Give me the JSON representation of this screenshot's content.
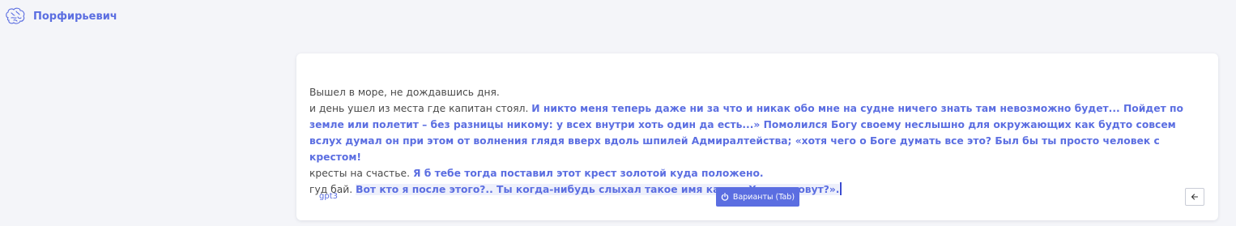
{
  "app": {
    "title": "Порфирьевич",
    "logo_icon": "brain-icon"
  },
  "editor": {
    "lines": [
      {
        "user": "Вышел в море, не дождавшись дня.",
        "generated": ""
      },
      {
        "user": "и день ушел из места где капитан стоял.",
        "generated": "И никто меня теперь даже ни за что и никак обо мне на судне ничего знать там невозможно будет... Пойдет по земле или полетит – без разницы никому: у всех внутри хоть один да есть...» Помолился Богу своему неслышно для окружающих как будто совсем вслух думал он при этом от волнения глядя вверх вдоль шпилей Адмиралтейства; «хотя чего о Боге думать все это? Был бы ты просто человек с крестом!"
      },
      {
        "user": "кресты на счастье.",
        "generated": "Я б тебе тогда поставил этот крест золотой куда положено."
      },
      {
        "user": "гуд бай.",
        "generated": "Вот кто я после этого?.. Ты когда-нибудь слыхал такое имя какого Христа зовут?»."
      }
    ]
  },
  "footer": {
    "model": "gpt3",
    "variants_label": "Варианты (Tab)",
    "variants_icon": "power-icon",
    "back_icon": "arrow-left-icon"
  },
  "colors": {
    "accent": "#5b6ee1",
    "text": "#4a4a4a",
    "background": "#f4f5f9",
    "card": "#ffffff"
  }
}
